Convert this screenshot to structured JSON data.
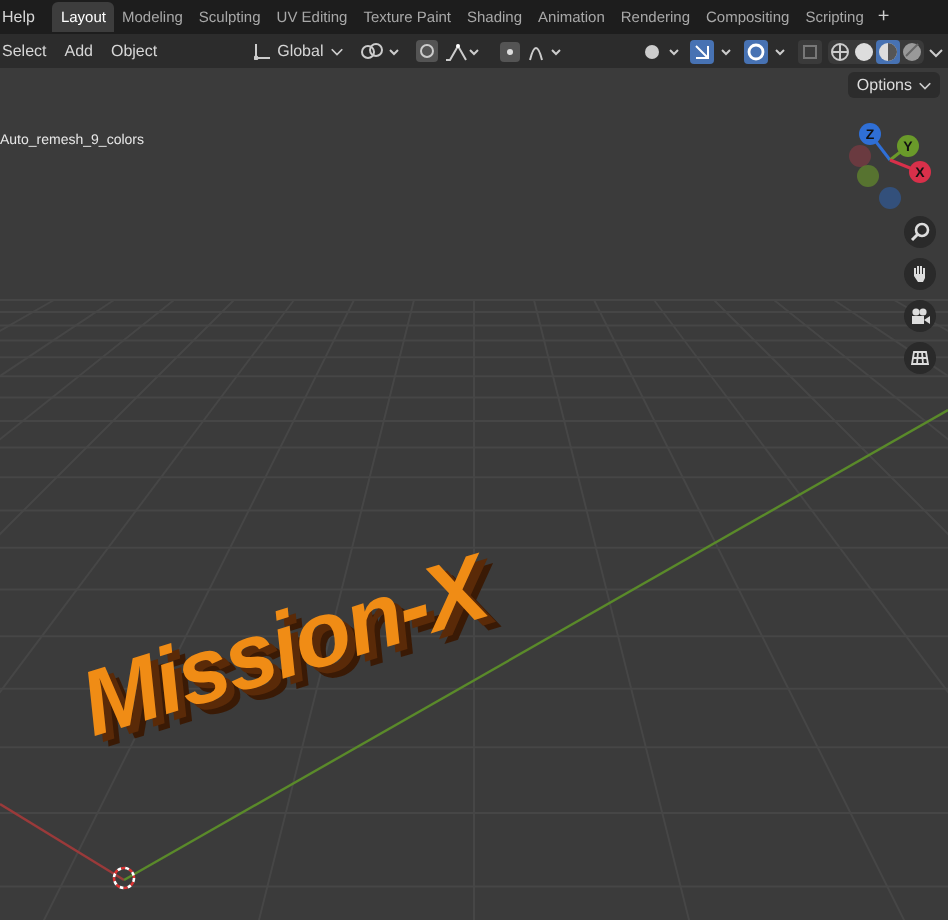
{
  "top_menu": [
    "Help"
  ],
  "workspace_tabs": [
    {
      "label": "Layout",
      "selected": true
    },
    {
      "label": "Modeling",
      "selected": false
    },
    {
      "label": "Sculpting",
      "selected": false
    },
    {
      "label": "UV Editing",
      "selected": false
    },
    {
      "label": "Texture Paint",
      "selected": false
    },
    {
      "label": "Shading",
      "selected": false
    },
    {
      "label": "Animation",
      "selected": false
    },
    {
      "label": "Rendering",
      "selected": false
    },
    {
      "label": "Compositing",
      "selected": false
    },
    {
      "label": "Scripting",
      "selected": false
    }
  ],
  "add_tab": "+",
  "header_menus": [
    "Select",
    "Add",
    "Object"
  ],
  "orientation": "Global",
  "shading_modes": [
    {
      "kind": "wireframe",
      "selected": false
    },
    {
      "kind": "solid",
      "selected": false
    },
    {
      "kind": "material",
      "selected": true
    },
    {
      "kind": "rendered",
      "selected": false
    }
  ],
  "options_button": "Options",
  "object_name": "Auto_remesh_9_colors",
  "gizmo_axes": [
    {
      "label": "Z",
      "color": "#2f6fd6"
    },
    {
      "label": "Y",
      "color": "#6a9a2a"
    },
    {
      "label": "X",
      "color": "#d8304a"
    }
  ],
  "viewport_text": "Mission-X"
}
